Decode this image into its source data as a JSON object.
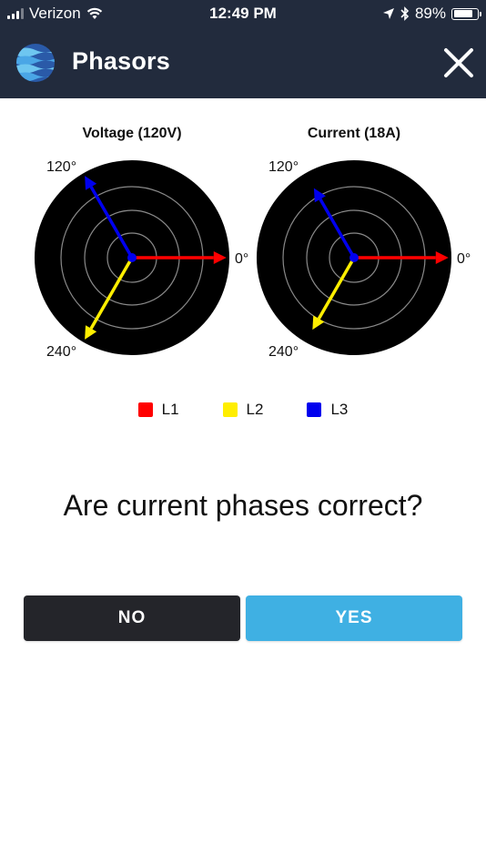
{
  "status_bar": {
    "carrier": "Verizon",
    "time": "12:49 PM",
    "battery": "89%",
    "battery_level": 0.89
  },
  "header": {
    "title": "Phasors"
  },
  "charts": [
    {
      "title": "Voltage (120V)",
      "labels": {
        "deg0": "0°",
        "deg120": "120°",
        "deg240": "240°"
      },
      "phasors": [
        {
          "name": "L1",
          "angle_deg": 0,
          "magnitude": 1.0,
          "color": "#ff0000"
        },
        {
          "name": "L2",
          "angle_deg": 240,
          "magnitude": 1.0,
          "color": "#ffee00"
        },
        {
          "name": "L3",
          "angle_deg": 120,
          "magnitude": 1.0,
          "color": "#0000ee"
        }
      ]
    },
    {
      "title": "Current (18A)",
      "labels": {
        "deg0": "0°",
        "deg120": "120°",
        "deg240": "240°"
      },
      "phasors": [
        {
          "name": "L1",
          "angle_deg": 0,
          "magnitude": 1.0,
          "color": "#ff0000"
        },
        {
          "name": "L2",
          "angle_deg": 240,
          "magnitude": 0.88,
          "color": "#ffee00"
        },
        {
          "name": "L3",
          "angle_deg": 120,
          "magnitude": 0.85,
          "color": "#0000ee"
        }
      ]
    }
  ],
  "legend": [
    {
      "label": "L1",
      "color": "#ff0000"
    },
    {
      "label": "L2",
      "color": "#ffee00"
    },
    {
      "label": "L3",
      "color": "#0000ee"
    }
  ],
  "question": "Are current phases correct?",
  "buttons": {
    "no": "NO",
    "yes": "YES"
  }
}
